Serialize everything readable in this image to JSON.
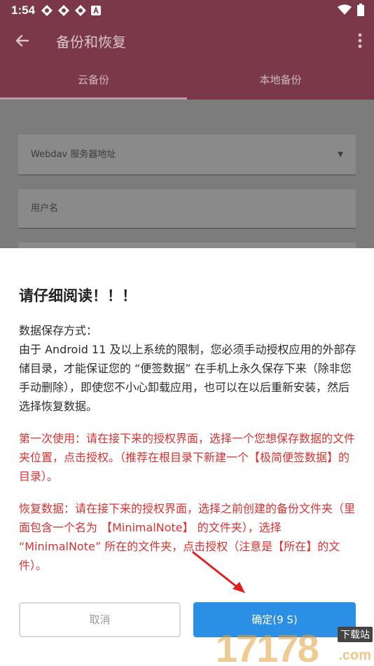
{
  "status_bar": {
    "time": "1:54"
  },
  "app_bar": {
    "title": "备份和恢复"
  },
  "tabs": [
    {
      "label": "云备份",
      "active": true
    },
    {
      "label": "本地备份",
      "active": false
    }
  ],
  "form": {
    "server_placeholder": "Webdav 服务器地址",
    "username_placeholder": "用户名"
  },
  "dialog": {
    "title": "请仔细阅读！！！",
    "body_heading": "数据保存方式：",
    "body_text": "由于 Android 11 及以上系统的限制，您必须手动授权应用的外部存储目录，才能保证您的 “便签数据” 在手机上永久保存下来（除非您手动删除），即使您不小心卸载应用，也可以在以后重新安装，然后选择恢复数据。",
    "first_use": "第一次使用：请在接下来的授权界面，选择一个您想保存数据的文件夹位置，点击授权。（推荐在根目录下新建一个【极简便签数据】的目录）。",
    "restore": "恢复数据：请在接下来的授权界面，选择之前创建的备份文件夹（里面包含一个名为 【MinimalNote】 的文件夹），选择 “MinimalNote” 所在的文件夹，点击授权（注意是【所在】的文件）。",
    "cancel_label": "取消",
    "confirm_label": "确定(9 S)"
  },
  "watermark": {
    "number": "17178",
    "tag": "下载站",
    "suffix": ".com"
  },
  "colors": {
    "app_bar": "#7a3848",
    "confirm_button": "#2c8fe6",
    "warning_text": "#d83232",
    "annotation_arrow": "#e02020"
  }
}
